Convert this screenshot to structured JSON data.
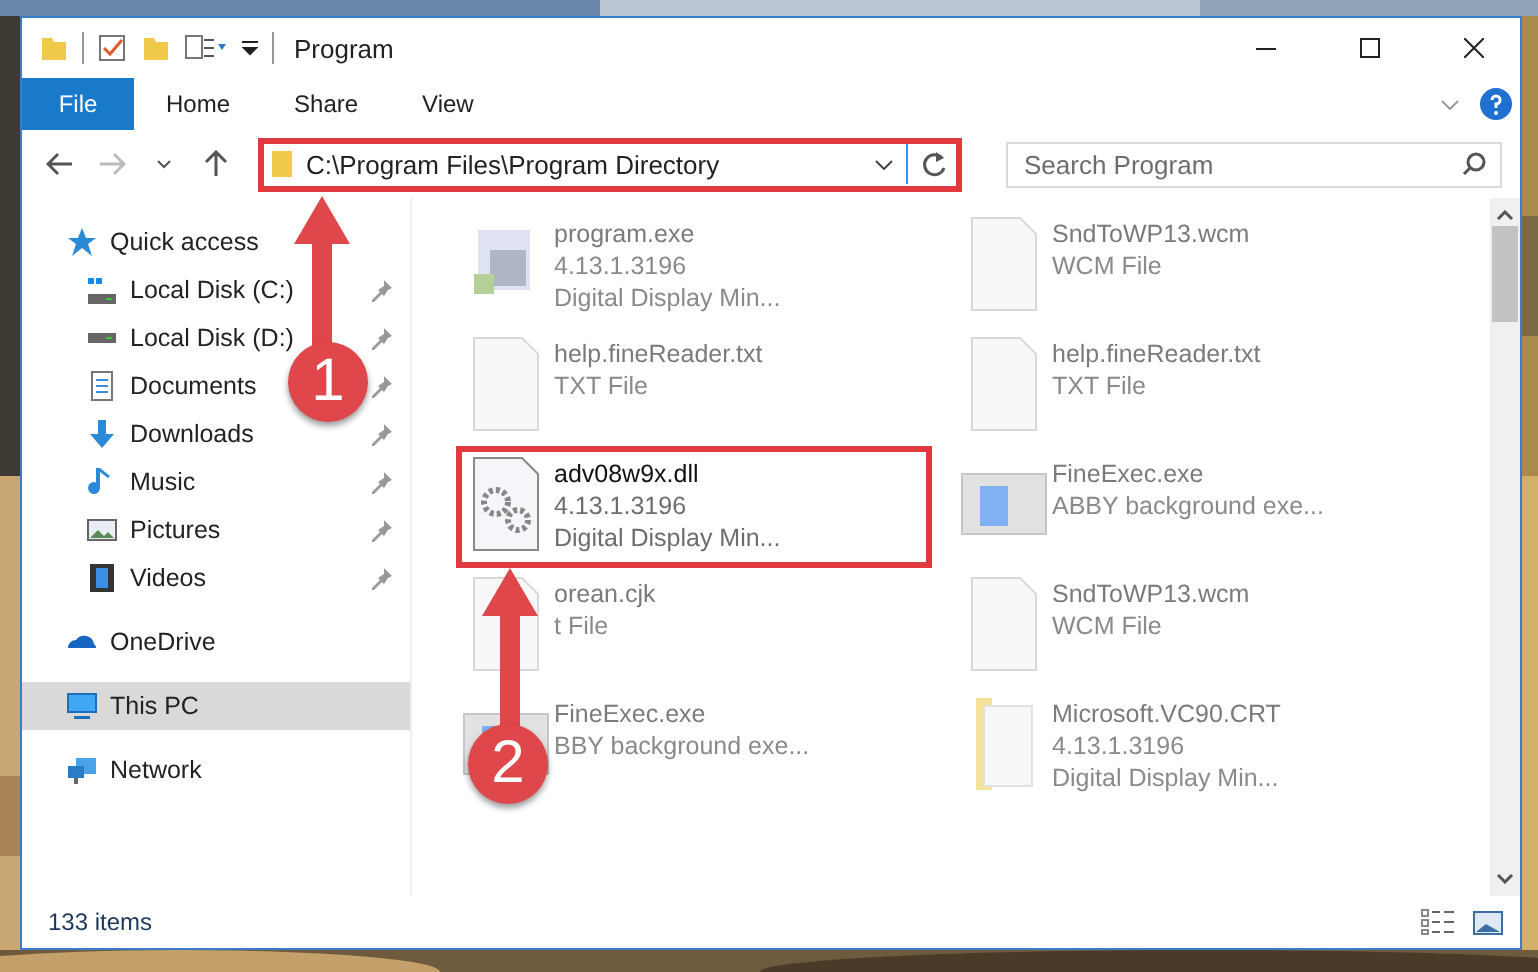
{
  "window": {
    "title": "Program"
  },
  "ribbon_tabs": [
    {
      "label": "File",
      "selected": true
    },
    {
      "label": "Home",
      "selected": false
    },
    {
      "label": "Share",
      "selected": false
    },
    {
      "label": "View",
      "selected": false
    }
  ],
  "address": {
    "path": "C:\\Program Files\\Program Directory",
    "highlighted": true
  },
  "search": {
    "placeholder": "Search Program"
  },
  "nav": [
    {
      "label": "Quick access",
      "kind": "star",
      "selected": false,
      "children": [
        {
          "label": "Local Disk (C:)",
          "kind": "systemdrive",
          "pinned": true,
          "selected": false
        },
        {
          "label": "Local Disk (D:)",
          "kind": "drive",
          "pinned": true,
          "selected": false
        },
        {
          "label": "Documents",
          "kind": "documents",
          "pinned": true,
          "selected": false
        },
        {
          "label": "Downloads",
          "kind": "downloads",
          "pinned": true,
          "selected": false
        },
        {
          "label": "Music",
          "kind": "music",
          "pinned": true,
          "selected": false
        },
        {
          "label": "Pictures",
          "kind": "pictures",
          "pinned": true,
          "selected": false
        },
        {
          "label": "Videos",
          "kind": "videos",
          "pinned": true,
          "selected": false
        }
      ]
    },
    {
      "label": "OneDrive",
      "kind": "cloud",
      "selected": false
    },
    {
      "label": "This PC",
      "kind": "pc",
      "selected": true
    },
    {
      "label": "Network",
      "kind": "network",
      "selected": false
    }
  ],
  "files": [
    {
      "name": "program.exe",
      "details": [
        "4.13.1.3196",
        "Digital Display Min..."
      ],
      "kind": "app",
      "blurred": true,
      "highlighted": false
    },
    {
      "name": "SndToWP13.wcm",
      "details": [
        "WCM File"
      ],
      "kind": "page",
      "blurred": true,
      "highlighted": false
    },
    {
      "name": "help.fineReader.txt",
      "details": [
        "TXT File"
      ],
      "kind": "page",
      "blurred": true,
      "highlighted": false
    },
    {
      "name": "help.fineReader.txt",
      "details": [
        "TXT File"
      ],
      "kind": "page",
      "blurred": true,
      "highlighted": false
    },
    {
      "name": "adv08w9x.dll",
      "details": [
        "4.13.1.3196",
        "Digital Display Min..."
      ],
      "kind": "dll",
      "blurred": false,
      "highlighted": true
    },
    {
      "name": "FineExec.exe",
      "details": [
        "ABBY background exe..."
      ],
      "kind": "window",
      "blurred": true,
      "highlighted": false
    },
    {
      "name": "orean.cjk",
      "details": [
        "t File"
      ],
      "kind": "page",
      "blurred": true,
      "highlighted": false
    },
    {
      "name": "SndToWP13.wcm",
      "details": [
        "WCM File"
      ],
      "kind": "page",
      "blurred": true,
      "highlighted": false
    },
    {
      "name": "FineExec.exe",
      "details": [
        "BBY background exe..."
      ],
      "kind": "window",
      "blurred": true,
      "highlighted": false
    },
    {
      "name": "Microsoft.VC90.CRT",
      "details": [
        "4.13.1.3196",
        "Digital Display Min..."
      ],
      "kind": "folder",
      "blurred": true,
      "highlighted": false
    }
  ],
  "status_bar": {
    "count": "133 items"
  },
  "callouts": [
    {
      "number": "1"
    },
    {
      "number": "2"
    }
  ]
}
